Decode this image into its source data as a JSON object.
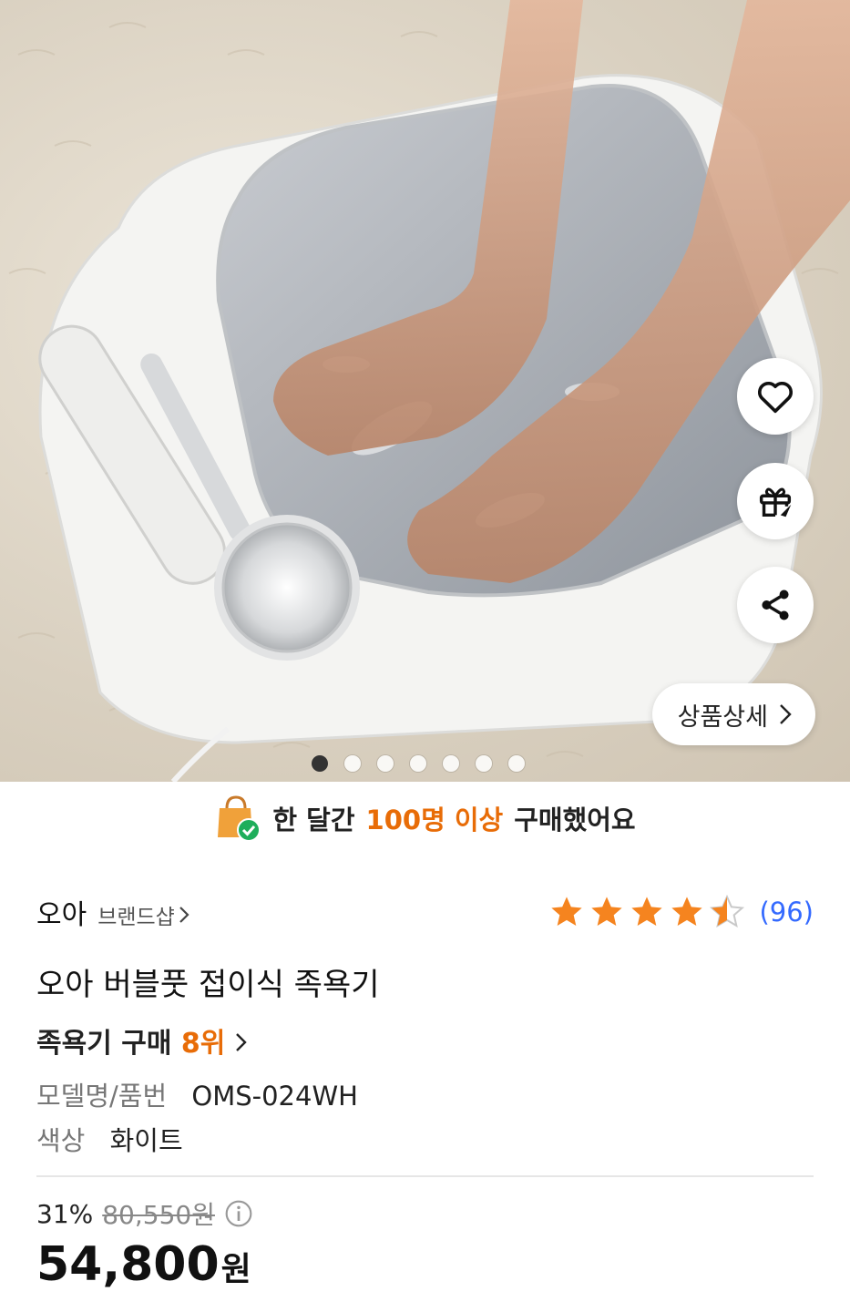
{
  "hero": {
    "image_alt": "foot spa photo",
    "slides_total": 7,
    "active_slide": 1,
    "detail_button_label": "상품상세"
  },
  "banner": {
    "prefix": "한 달간",
    "highlight": "100명 이상",
    "suffix": "구매했어요"
  },
  "brand": {
    "name": "오아",
    "shop_label": "브랜드샵"
  },
  "rating": {
    "value": 4.5,
    "review_count": "(96)"
  },
  "product": {
    "title": "오아 버블풋 접이식 족욕기",
    "rank_prefix": "족욕기 구매",
    "rank_value": "8위"
  },
  "specs": {
    "model_label": "모델명/품번",
    "model_value": "OMS-024WH",
    "color_label": "색상",
    "color_value": "화이트"
  },
  "price": {
    "discount": "31%",
    "original": "80,550원",
    "sale_amount": "54,800",
    "sale_unit": "원"
  },
  "colors": {
    "accent_orange": "#e86c07",
    "star": "#f5841f",
    "review_blue": "#346aff"
  }
}
